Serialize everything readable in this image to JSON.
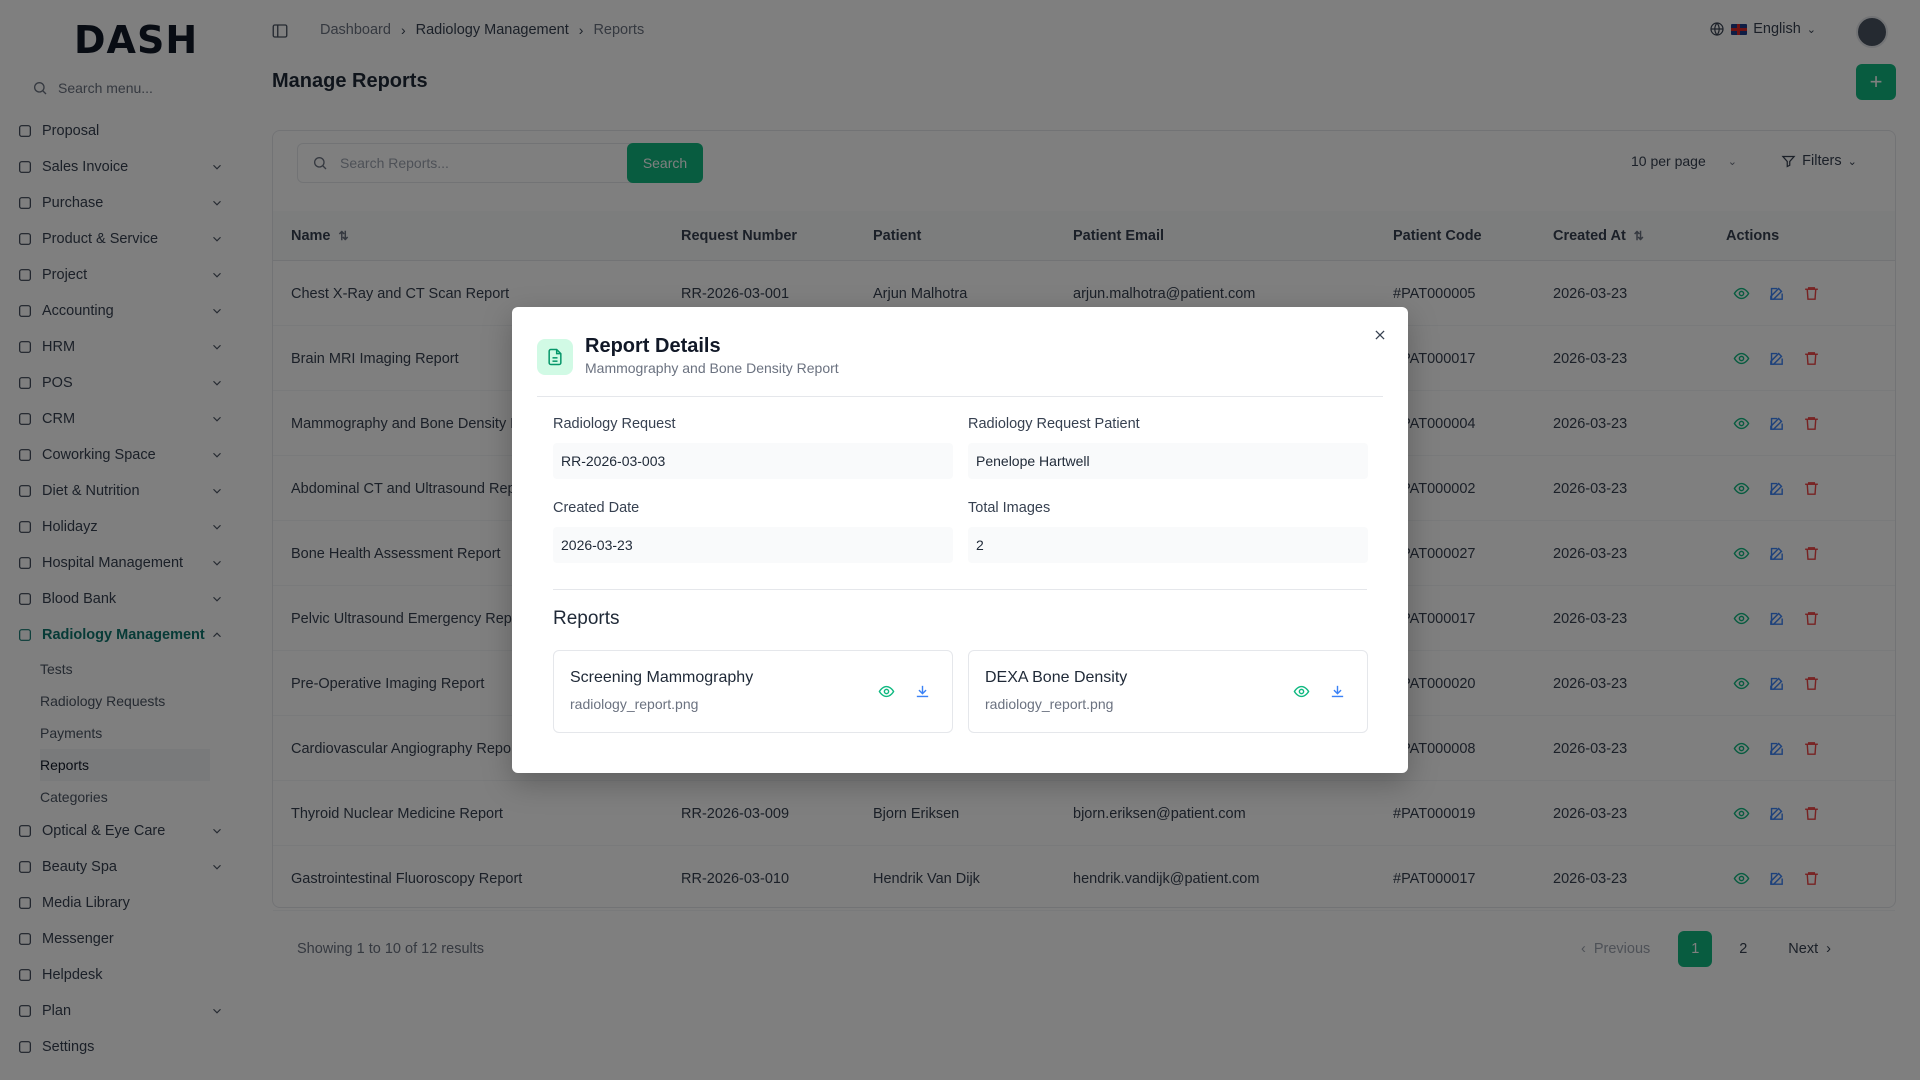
{
  "app": {
    "logo": "DASH"
  },
  "sidebar": {
    "search_placeholder": "Search menu...",
    "items": [
      {
        "label": "Proposal",
        "icon": "proposal-icon",
        "chevron": false
      },
      {
        "label": "Sales Invoice",
        "icon": "invoice-icon",
        "chevron": true
      },
      {
        "label": "Purchase",
        "icon": "cart-icon",
        "chevron": true
      },
      {
        "label": "Product & Service",
        "icon": "layers-icon",
        "chevron": true
      },
      {
        "label": "Project",
        "icon": "folder-icon",
        "chevron": true
      },
      {
        "label": "Accounting",
        "icon": "calculator-icon",
        "chevron": true
      },
      {
        "label": "HRM",
        "icon": "users-icon",
        "chevron": true
      },
      {
        "label": "POS",
        "icon": "store-icon",
        "chevron": true
      },
      {
        "label": "CRM",
        "icon": "crm-icon",
        "chevron": true
      },
      {
        "label": "Coworking Space",
        "icon": "wifi-icon",
        "chevron": true
      },
      {
        "label": "Diet & Nutrition",
        "icon": "apple-icon",
        "chevron": true
      },
      {
        "label": "Holidayz",
        "icon": "holiday-icon",
        "chevron": true
      },
      {
        "label": "Hospital Management",
        "icon": "stethoscope-icon",
        "chevron": true
      },
      {
        "label": "Blood Bank",
        "icon": "droplet-icon",
        "chevron": true
      },
      {
        "label": "Radiology Management",
        "icon": "radiology-icon",
        "chevron": true,
        "active": true
      }
    ],
    "sub_items": [
      "Tests",
      "Radiology Requests",
      "Payments",
      "Reports",
      "Categories"
    ],
    "items_after": [
      {
        "label": "Optical & Eye Care",
        "icon": "eye-icon",
        "chevron": true
      },
      {
        "label": "Beauty Spa",
        "icon": "scissors-icon",
        "chevron": true
      },
      {
        "label": "Media Library",
        "icon": "image-icon",
        "chevron": false
      },
      {
        "label": "Messenger",
        "icon": "message-icon",
        "chevron": false
      },
      {
        "label": "Helpdesk",
        "icon": "headset-icon",
        "chevron": false
      },
      {
        "label": "Plan",
        "icon": "card-icon",
        "chevron": true
      },
      {
        "label": "Settings",
        "icon": "gear-icon",
        "chevron": false
      }
    ]
  },
  "header": {
    "breadcrumbs": [
      "Dashboard",
      "Radiology Management",
      "Reports"
    ],
    "language": "English"
  },
  "page": {
    "title": "Manage Reports",
    "add_label": "+",
    "search_placeholder": "Search Reports...",
    "search_button": "Search",
    "per_page": "10 per page",
    "filters": "Filters"
  },
  "table": {
    "columns": [
      "Name",
      "Request Number",
      "Patient",
      "Patient Email",
      "Patient Code",
      "Created At",
      "Actions"
    ],
    "rows": [
      [
        "Chest X-Ray and CT Scan Report",
        "RR-2026-03-001",
        "Arjun Malhotra",
        "arjun.malhotra@patient.com",
        "#PAT000005",
        "2026-03-23"
      ],
      [
        "Brain MRI Imaging Report",
        "",
        "",
        "",
        "#PAT000017",
        "2026-03-23"
      ],
      [
        "Mammography and Bone Density Re",
        "",
        "",
        "",
        "#PAT000004",
        "2026-03-23"
      ],
      [
        "Abdominal CT and Ultrasound Repo",
        "",
        "",
        "",
        "#PAT000002",
        "2026-03-23"
      ],
      [
        "Bone Health Assessment Report",
        "",
        "",
        "",
        "#PAT000027",
        "2026-03-23"
      ],
      [
        "Pelvic Ultrasound Emergency Repor",
        "",
        "",
        "",
        "#PAT000017",
        "2026-03-23"
      ],
      [
        "Pre-Operative Imaging Report",
        "",
        "",
        "",
        "#PAT000020",
        "2026-03-23"
      ],
      [
        "Cardiovascular Angiography Report",
        "",
        "",
        "",
        "#PAT000008",
        "2026-03-23"
      ],
      [
        "Thyroid Nuclear Medicine Report",
        "RR-2026-03-009",
        "Bjorn Eriksen",
        "bjorn.eriksen@patient.com",
        "#PAT000019",
        "2026-03-23"
      ],
      [
        "Gastrointestinal Fluoroscopy Report",
        "RR-2026-03-010",
        "Hendrik Van Dijk",
        "hendrik.vandijk@patient.com",
        "#PAT000017",
        "2026-03-23"
      ]
    ],
    "footer": "Showing 1 to 10 of 12 results",
    "pagination": {
      "prev": "Previous",
      "pages": [
        "1",
        "2"
      ],
      "next": "Next"
    }
  },
  "modal": {
    "title": "Report Details",
    "subtitle": "Mammography and Bone Density Report",
    "fields": {
      "radiology_request_label": "Radiology Request",
      "radiology_request_value": "RR-2026-03-003",
      "patient_label": "Radiology Request Patient",
      "patient_value": "Penelope Hartwell",
      "created_label": "Created Date",
      "created_value": "2026-03-23",
      "images_label": "Total Images",
      "images_value": "2"
    },
    "reports_heading": "Reports",
    "reports": [
      {
        "title": "Screening Mammography",
        "file": "radiology_report.png"
      },
      {
        "title": "DEXA Bone Density",
        "file": "radiology_report.png"
      }
    ]
  },
  "colors": {
    "accent": "#10b981",
    "active_nav": "#0f766e",
    "danger": "#ef4444",
    "info": "#3b82f6"
  }
}
